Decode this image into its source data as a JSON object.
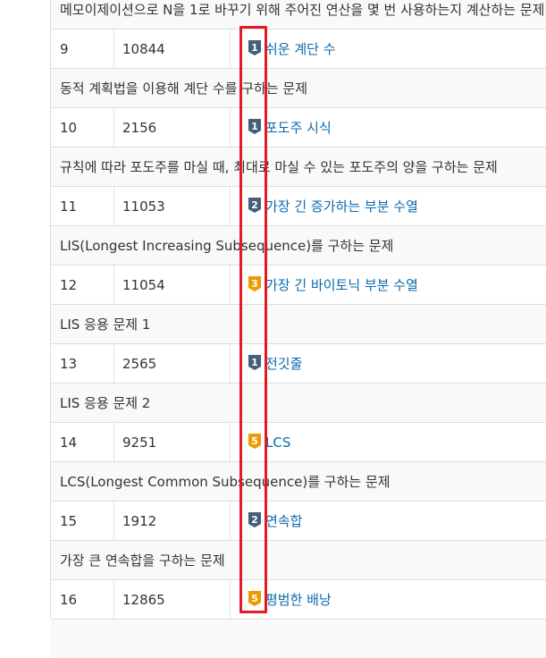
{
  "colors": {
    "link": "#0b6aad",
    "tier_silver": "#435f7a",
    "tier_gold": "#ec9a00",
    "highlight": "#e01b24",
    "row_shade": "#f9f9f9",
    "border": "#dddddd"
  },
  "table": {
    "top_desc": "메모이제이션으로 N을 1로 바꾸기 위해 주어진 연산을 몇 번 사용하는지 계산하는 문제",
    "rows": [
      {
        "num": "9",
        "id": "10844",
        "tier": "1",
        "tier_color": "silver",
        "title": "쉬운 계단 수",
        "desc": "동적 계획법을 이용해 계단 수를 구하는 문제"
      },
      {
        "num": "10",
        "id": "2156",
        "tier": "1",
        "tier_color": "silver",
        "title": "포도주 시식",
        "desc": "규칙에 따라 포도주를 마실 때, 최대로 마실 수 있는 포도주의 양을 구하는 문제"
      },
      {
        "num": "11",
        "id": "11053",
        "tier": "2",
        "tier_color": "silver",
        "title": "가장 긴 증가하는 부분 수열",
        "desc": "LIS(Longest Increasing Subsequence)를 구하는 문제"
      },
      {
        "num": "12",
        "id": "11054",
        "tier": "3",
        "tier_color": "gold",
        "title": "가장 긴 바이토닉 부분 수열",
        "desc": "LIS 응용 문제 1"
      },
      {
        "num": "13",
        "id": "2565",
        "tier": "1",
        "tier_color": "silver",
        "title": "전깃줄",
        "desc": "LIS 응용 문제 2"
      },
      {
        "num": "14",
        "id": "9251",
        "tier": "5",
        "tier_color": "gold",
        "title": "LCS",
        "desc": "LCS(Longest Common Subsequence)를 구하는 문제"
      },
      {
        "num": "15",
        "id": "1912",
        "tier": "2",
        "tier_color": "silver",
        "title": "연속합",
        "desc": "가장 큰 연속합을 구하는 문제"
      },
      {
        "num": "16",
        "id": "12865",
        "tier": "5",
        "tier_color": "gold",
        "title": "평범한 배낭",
        "desc": ""
      }
    ]
  }
}
